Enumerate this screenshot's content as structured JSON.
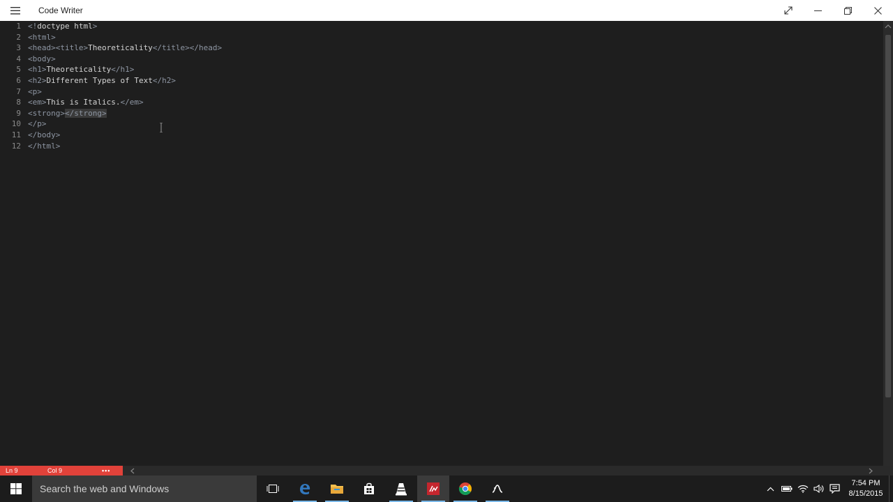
{
  "window": {
    "title": "Code Writer"
  },
  "editor": {
    "lines": [
      {
        "num": "1",
        "tokens": [
          {
            "t": "tag",
            "v": "<!"
          },
          {
            "t": "text",
            "v": "doctype html"
          },
          {
            "t": "tag",
            "v": ">"
          }
        ]
      },
      {
        "num": "2",
        "tokens": [
          {
            "t": "tag",
            "v": "<html>"
          }
        ]
      },
      {
        "num": "3",
        "tokens": [
          {
            "t": "tag",
            "v": "<head><title>"
          },
          {
            "t": "text",
            "v": "Theoreticality"
          },
          {
            "t": "tag",
            "v": "</title></head>"
          }
        ]
      },
      {
        "num": "4",
        "tokens": [
          {
            "t": "tag",
            "v": "<body>"
          }
        ]
      },
      {
        "num": "5",
        "tokens": [
          {
            "t": "tag",
            "v": "<h1>"
          },
          {
            "t": "text",
            "v": "Theoreticality"
          },
          {
            "t": "tag",
            "v": "</h1>"
          }
        ]
      },
      {
        "num": "6",
        "tokens": [
          {
            "t": "tag",
            "v": "<h2>"
          },
          {
            "t": "text",
            "v": "Different Types of Text"
          },
          {
            "t": "tag",
            "v": "</h2>"
          }
        ]
      },
      {
        "num": "7",
        "tokens": [
          {
            "t": "tag",
            "v": "<p>"
          }
        ]
      },
      {
        "num": "8",
        "tokens": [
          {
            "t": "tag",
            "v": "<em>"
          },
          {
            "t": "text",
            "v": "This is Italics."
          },
          {
            "t": "tag",
            "v": "</em>"
          }
        ]
      },
      {
        "num": "9",
        "tokens": [
          {
            "t": "tag",
            "v": "<strong>"
          },
          {
            "t": "tag",
            "v": "</strong>",
            "hl": true
          }
        ]
      },
      {
        "num": "10",
        "tokens": [
          {
            "t": "tag",
            "v": "</p>"
          }
        ]
      },
      {
        "num": "11",
        "tokens": [
          {
            "t": "tag",
            "v": "</body>"
          }
        ]
      },
      {
        "num": "12",
        "tokens": [
          {
            "t": "tag",
            "v": "</html>"
          }
        ]
      }
    ]
  },
  "status": {
    "line": "Ln 9",
    "col": "Col 9",
    "more": "•••",
    "accent_color": "#e1423a"
  },
  "taskbar": {
    "search_placeholder": "Search the web and Windows",
    "apps": [
      "task-view-icon",
      "edge-icon",
      "file-explorer-icon",
      "store-icon",
      "vlc-icon",
      "code-writer-icon",
      "chrome-icon",
      "app-icon"
    ],
    "time": "7:54 PM",
    "date": "8/15/2015"
  }
}
